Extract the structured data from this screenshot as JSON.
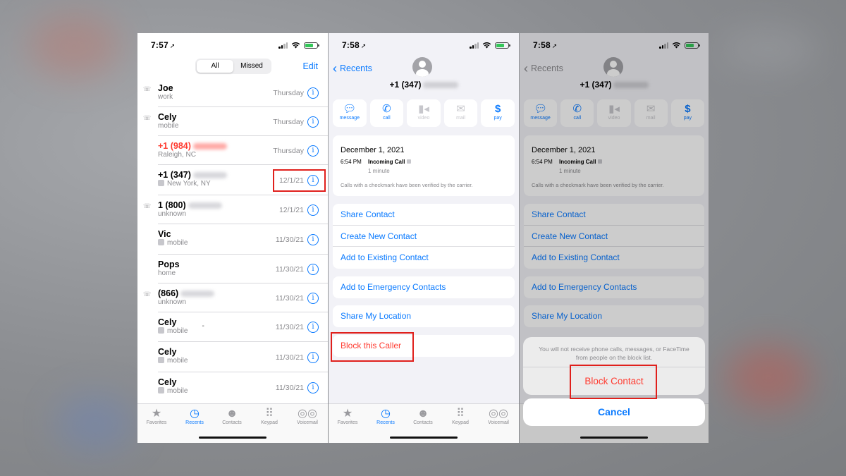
{
  "colors": {
    "accent": "#0a7aff",
    "destructive": "#ff3b30",
    "highlight": "#e0201c"
  },
  "phone1": {
    "time": "7:57",
    "segments": [
      "All",
      "Missed"
    ],
    "edit": "Edit",
    "rows": [
      {
        "name": "Joe",
        "sub": "work",
        "date": "Thursday"
      },
      {
        "name": "Cely",
        "sub": "mobile",
        "date": "Thursday"
      },
      {
        "name": "+1 (984)",
        "sub": "Raleigh, NC",
        "date": "Thursday"
      },
      {
        "name": "+1 (347)",
        "sub": "New York, NY",
        "date": "12/1/21"
      },
      {
        "name": "1 (800)",
        "sub": "unknown",
        "date": "12/1/21"
      },
      {
        "name": "Vic",
        "sub": "mobile",
        "date": "11/30/21"
      },
      {
        "name": "Pops",
        "sub": "home",
        "date": "11/30/21"
      },
      {
        "name": "(866)",
        "sub": "unknown",
        "date": "11/30/21"
      },
      {
        "name": "Cely",
        "sub": "mobile",
        "date": "11/30/21",
        "extra": "-"
      },
      {
        "name": "Cely",
        "sub": "mobile",
        "date": "11/30/21"
      },
      {
        "name": "Cely",
        "sub": "mobile",
        "date": "11/30/21"
      }
    ]
  },
  "tabs": [
    "Favorites",
    "Recents",
    "Contacts",
    "Keypad",
    "Voicemail"
  ],
  "detail": {
    "time": "7:58",
    "back": "Recents",
    "number": "+1 (347)",
    "actions": [
      "message",
      "call",
      "video",
      "mail",
      "pay"
    ],
    "date": "December 1, 2021",
    "call_time": "6:54 PM",
    "call_kind": "Incoming Call",
    "duration": "1 minute",
    "note": "Calls with a checkmark have been verified by the carrier.",
    "menu1": [
      "Share Contact",
      "Create New Contact",
      "Add to Existing Contact"
    ],
    "emergency": "Add to Emergency Contacts",
    "share_location": "Share My Location",
    "block": "Block this Caller"
  },
  "sheet": {
    "message": "You will not receive phone calls, messages, or FaceTime from people on the block list.",
    "block": "Block Contact",
    "cancel": "Cancel"
  }
}
